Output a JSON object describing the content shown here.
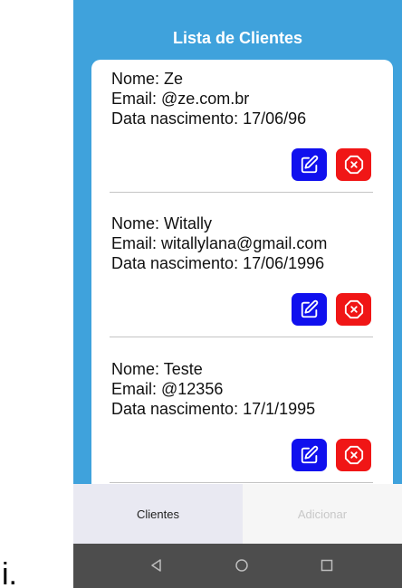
{
  "outer_label": "i.",
  "header": {
    "title": "Lista de Clientes"
  },
  "clients": [
    {
      "name_line": "Nome: Ze",
      "email_line": "Email: @ze.com.br",
      "birth_line": "Data nascimento: 17/06/96"
    },
    {
      "name_line": "Nome: Witally",
      "email_line": "Email: witallylana@gmail.com",
      "birth_line": "Data nascimento: 17/06/1996"
    },
    {
      "name_line": "Nome: Teste",
      "email_line": "Email: @12356",
      "birth_line": "Data nascimento: 17/1/1995"
    }
  ],
  "tabs": {
    "clientes_label": "Clientes",
    "adicionar_label": "Adicionar",
    "active": "Clientes"
  },
  "icons": {
    "edit": "edit-icon",
    "delete": "delete-icon",
    "back": "back-icon",
    "home": "home-icon",
    "recents": "recents-icon"
  },
  "colors": {
    "header_bg": "#3fa2dc",
    "edit_button": "#1010ee",
    "delete_button": "#f01616",
    "nav_bar": "#4d4d4d"
  }
}
